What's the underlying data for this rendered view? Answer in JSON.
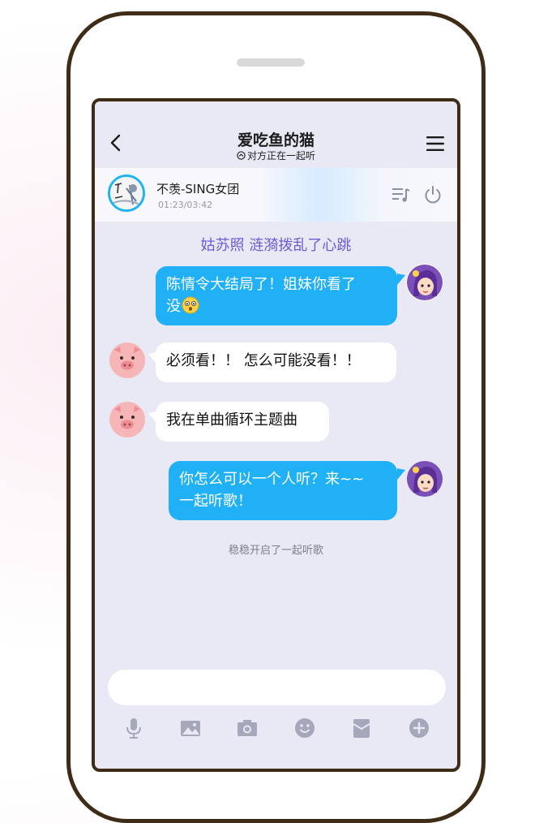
{
  "header": {
    "title": "爱吃鱼的猫",
    "subtitle": "对方正在一起听"
  },
  "player": {
    "song": "不羡-SING女团",
    "time": "01:23/03:42"
  },
  "banner": "姑苏照 涟漪拨乱了心跳",
  "messages": [
    {
      "from": "me",
      "line1": "陈情令大结局了！姐妹你看了",
      "line2": "没",
      "emoji": "astonished-face-emoji"
    },
    {
      "from": "other",
      "text": "必须看！！ 怎么可能没看！！"
    },
    {
      "from": "other",
      "text": "我在单曲循环主题曲"
    },
    {
      "from": "me",
      "line1": "你怎么可以一个人听？来~~",
      "line2": "一起听歌！"
    }
  ],
  "system_message": "稳稳开启了一起听歌",
  "icons": {
    "toolbar": [
      "microphone-icon",
      "image-icon",
      "camera-icon",
      "emoji-icon",
      "red-packet-icon",
      "plus-icon"
    ]
  },
  "colors": {
    "accent": "#1fb0f6",
    "banner_text": "#6d5ad8",
    "frame": "#3e2c17",
    "chat_bg": "#e8e9f4"
  }
}
